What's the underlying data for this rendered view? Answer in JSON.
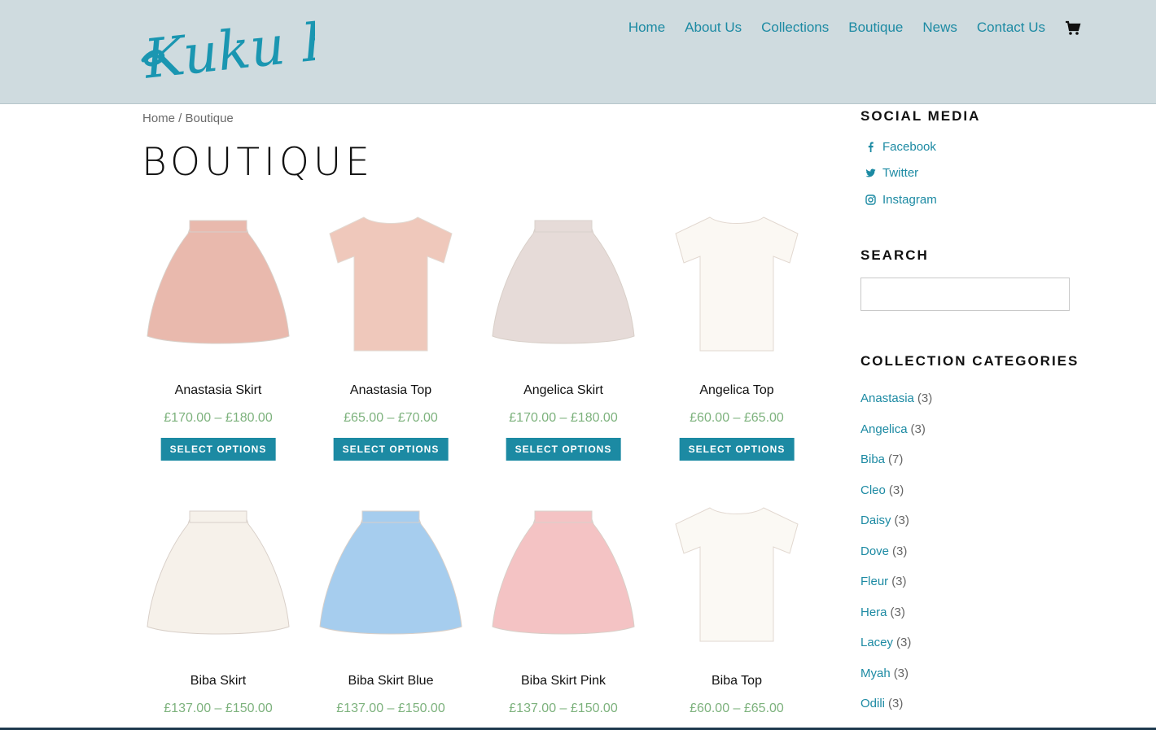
{
  "header": {
    "logo_text": "Kuku B",
    "nav": [
      "Home",
      "About Us",
      "Collections",
      "Boutique",
      "News",
      "Contact Us"
    ],
    "cart_icon": "cart-icon"
  },
  "breadcrumb": {
    "home": "Home",
    "separator": " / ",
    "current": "Boutique"
  },
  "page_title": "BOUTIQUE",
  "products": [
    {
      "name": "Anastasia Skirt",
      "price": "£170.00 – £180.00",
      "button": "SELECT OPTIONS",
      "color": "#e9b9ad",
      "type": "skirt"
    },
    {
      "name": "Anastasia Top",
      "price": "£65.00 – £70.00",
      "button": "SELECT OPTIONS",
      "color": "#efc8bb",
      "type": "top"
    },
    {
      "name": "Angelica Skirt",
      "price": "£170.00 – £180.00",
      "button": "SELECT OPTIONS",
      "color": "#e6dbd8",
      "type": "skirt"
    },
    {
      "name": "Angelica Top",
      "price": "£60.00 – £65.00",
      "button": "SELECT OPTIONS",
      "color": "#fbf8f3",
      "type": "top"
    },
    {
      "name": "Biba Skirt",
      "price": "£137.00 – £150.00",
      "color": "#f6f1ea",
      "type": "skirt"
    },
    {
      "name": "Biba Skirt Blue",
      "price": "£137.00 – £150.00",
      "color": "#a6cdee",
      "type": "skirt"
    },
    {
      "name": "Biba Skirt Pink",
      "price": "£137.00 – £150.00",
      "color": "#f4c3c4",
      "type": "skirt"
    },
    {
      "name": "Biba Top",
      "price": "£60.00 – £65.00",
      "color": "#fbf9f4",
      "type": "top"
    }
  ],
  "sidebar": {
    "social_title": "SOCIAL MEDIA",
    "social": [
      {
        "label": "Facebook",
        "icon": "facebook-icon"
      },
      {
        "label": "Twitter",
        "icon": "twitter-icon"
      },
      {
        "label": "Instagram",
        "icon": "instagram-icon"
      }
    ],
    "search_title": "SEARCH",
    "search_value": "",
    "categories_title": "COLLECTION CATEGORIES",
    "categories": [
      {
        "name": "Anastasia",
        "count": "(3)"
      },
      {
        "name": "Angelica",
        "count": "(3)"
      },
      {
        "name": "Biba",
        "count": "(7)"
      },
      {
        "name": "Cleo",
        "count": "(3)"
      },
      {
        "name": "Daisy",
        "count": "(3)"
      },
      {
        "name": "Dove",
        "count": "(3)"
      },
      {
        "name": "Fleur",
        "count": "(3)"
      },
      {
        "name": "Hera",
        "count": "(3)"
      },
      {
        "name": "Lacey",
        "count": "(3)"
      },
      {
        "name": "Myah",
        "count": "(3)"
      },
      {
        "name": "Odili",
        "count": "(3)"
      }
    ]
  },
  "colors": {
    "accent": "#1c8aa3",
    "header_bg": "#cfdbdf",
    "price": "#7db27d"
  }
}
